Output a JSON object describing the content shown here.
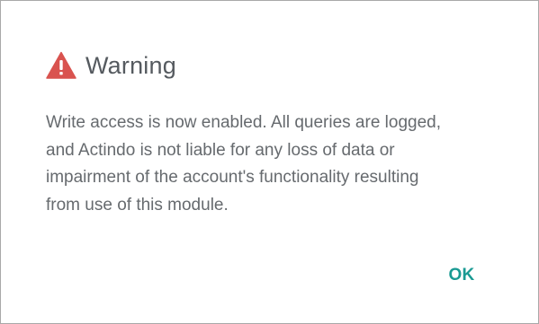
{
  "dialog": {
    "title": "Warning",
    "icon": "warning-triangle-icon",
    "icon_color": "#d9534f",
    "message_lines": [
      "Write access is now enabled. All queries are logged,",
      "and Actindo is not liable for any loss of data or",
      "impairment of the account's functionality resulting",
      "from use of this module."
    ],
    "ok_label": "OK",
    "accent_color": "#1a9a93"
  }
}
